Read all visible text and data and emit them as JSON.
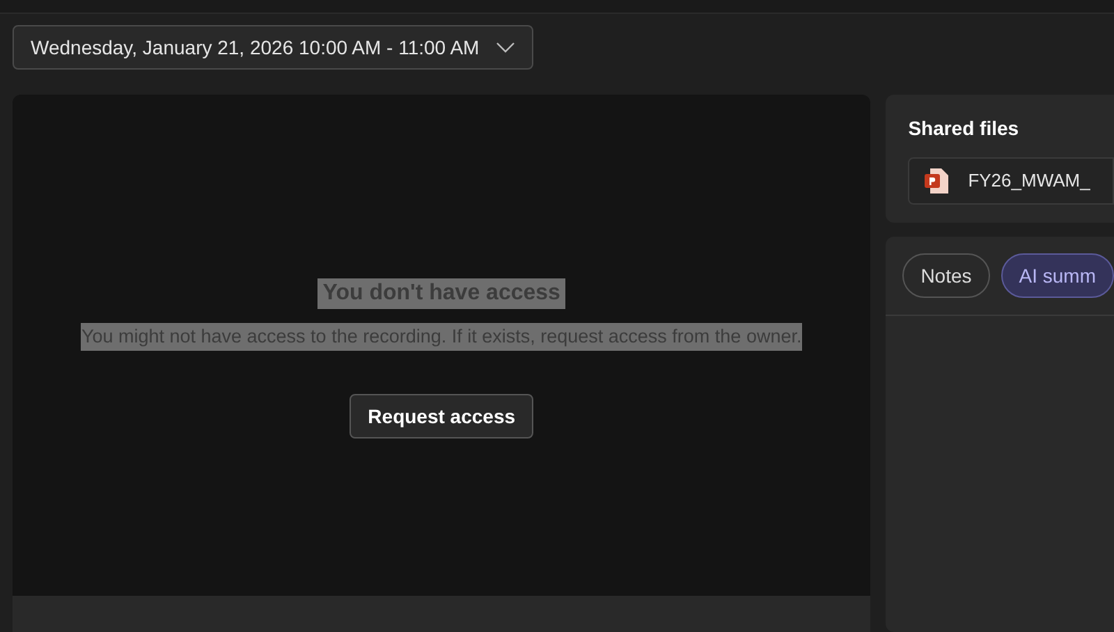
{
  "date_picker": {
    "value": "Wednesday, January 21, 2026 10:00 AM - 11:00 AM"
  },
  "recording": {
    "title": "You don't have access",
    "message": "You might not have access to the recording. If it exists, request access from the owner.",
    "button": "Request access"
  },
  "shared_files": {
    "title": "Shared files",
    "files": [
      {
        "name": "FY26_MWAM_"
      }
    ]
  },
  "tabs": [
    {
      "label": "Notes",
      "selected": false
    },
    {
      "label": "AI summ",
      "selected": true
    }
  ]
}
